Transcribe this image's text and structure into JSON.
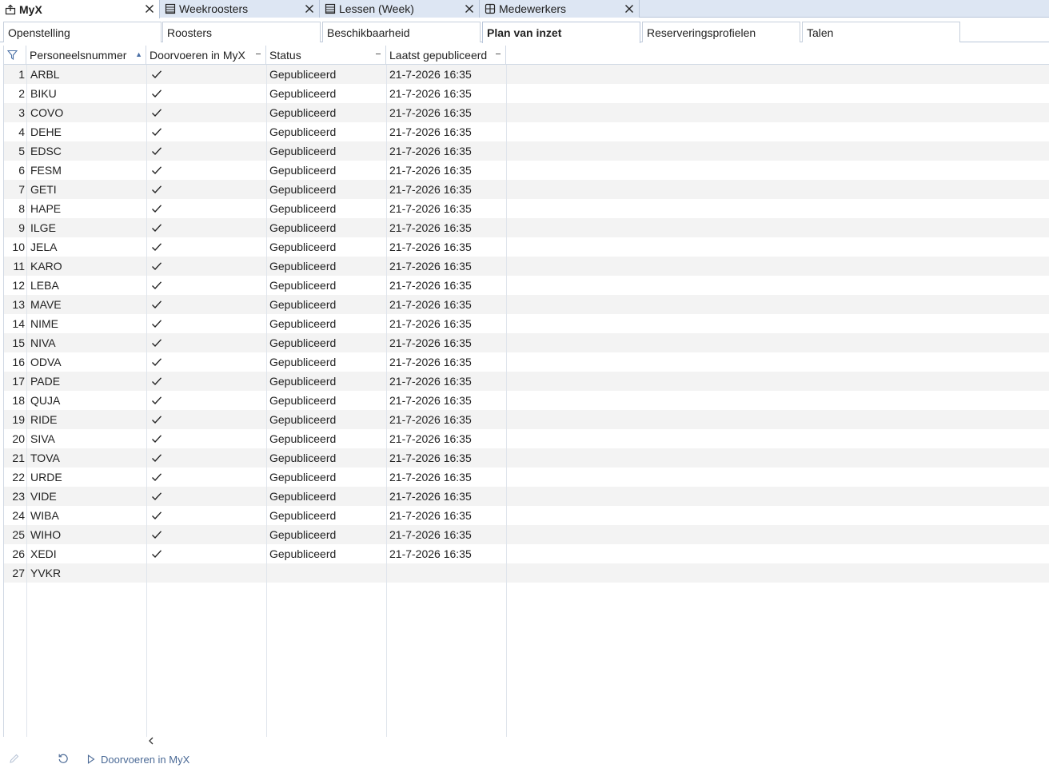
{
  "doc_tabs": [
    {
      "label": "MyX",
      "icon": "export-icon",
      "active": true
    },
    {
      "label": "Weekroosters",
      "icon": "table-icon",
      "active": false
    },
    {
      "label": "Lessen (Week)",
      "icon": "table-icon",
      "active": false
    },
    {
      "label": "Medewerkers",
      "icon": "grid-icon",
      "active": false
    }
  ],
  "sub_tabs": [
    {
      "label": "Openstelling"
    },
    {
      "label": "Roosters"
    },
    {
      "label": "Beschikbaarheid"
    },
    {
      "label": "Plan van inzet",
      "active": true
    },
    {
      "label": "Reserveringsprofielen"
    },
    {
      "label": "Talen"
    }
  ],
  "columns": {
    "personeelsnummer": "Personeelsnummer",
    "doorvoeren": "Doorvoeren in MyX",
    "status": "Status",
    "laatst": "Laatst gepubliceerd"
  },
  "rows": [
    {
      "n": "1",
      "pn": "ARBL",
      "checked": true,
      "status": "Gepubliceerd",
      "date": "21-7-2026 16:35"
    },
    {
      "n": "2",
      "pn": "BIKU",
      "checked": true,
      "status": "Gepubliceerd",
      "date": "21-7-2026 16:35"
    },
    {
      "n": "3",
      "pn": "COVO",
      "checked": true,
      "status": "Gepubliceerd",
      "date": "21-7-2026 16:35"
    },
    {
      "n": "4",
      "pn": "DEHE",
      "checked": true,
      "status": "Gepubliceerd",
      "date": "21-7-2026 16:35"
    },
    {
      "n": "5",
      "pn": "EDSC",
      "checked": true,
      "status": "Gepubliceerd",
      "date": "21-7-2026 16:35"
    },
    {
      "n": "6",
      "pn": "FESM",
      "checked": true,
      "status": "Gepubliceerd",
      "date": "21-7-2026 16:35"
    },
    {
      "n": "7",
      "pn": "GETI",
      "checked": true,
      "status": "Gepubliceerd",
      "date": "21-7-2026 16:35"
    },
    {
      "n": "8",
      "pn": "HAPE",
      "checked": true,
      "status": "Gepubliceerd",
      "date": "21-7-2026 16:35"
    },
    {
      "n": "9",
      "pn": "ILGE",
      "checked": true,
      "status": "Gepubliceerd",
      "date": "21-7-2026 16:35"
    },
    {
      "n": "10",
      "pn": "JELA",
      "checked": true,
      "status": "Gepubliceerd",
      "date": "21-7-2026 16:35"
    },
    {
      "n": "11",
      "pn": "KARO",
      "checked": true,
      "status": "Gepubliceerd",
      "date": "21-7-2026 16:35"
    },
    {
      "n": "12",
      "pn": "LEBA",
      "checked": true,
      "status": "Gepubliceerd",
      "date": "21-7-2026 16:35"
    },
    {
      "n": "13",
      "pn": "MAVE",
      "checked": true,
      "status": "Gepubliceerd",
      "date": "21-7-2026 16:35"
    },
    {
      "n": "14",
      "pn": "NIME",
      "checked": true,
      "status": "Gepubliceerd",
      "date": "21-7-2026 16:35"
    },
    {
      "n": "15",
      "pn": "NIVA",
      "checked": true,
      "status": "Gepubliceerd",
      "date": "21-7-2026 16:35"
    },
    {
      "n": "16",
      "pn": "ODVA",
      "checked": true,
      "status": "Gepubliceerd",
      "date": "21-7-2026 16:35"
    },
    {
      "n": "17",
      "pn": "PADE",
      "checked": true,
      "status": "Gepubliceerd",
      "date": "21-7-2026 16:35"
    },
    {
      "n": "18",
      "pn": "QUJA",
      "checked": true,
      "status": "Gepubliceerd",
      "date": "21-7-2026 16:35"
    },
    {
      "n": "19",
      "pn": "RIDE",
      "checked": true,
      "status": "Gepubliceerd",
      "date": "21-7-2026 16:35"
    },
    {
      "n": "20",
      "pn": "SIVA",
      "checked": true,
      "status": "Gepubliceerd",
      "date": "21-7-2026 16:35"
    },
    {
      "n": "21",
      "pn": "TOVA",
      "checked": true,
      "status": "Gepubliceerd",
      "date": "21-7-2026 16:35"
    },
    {
      "n": "22",
      "pn": "URDE",
      "checked": true,
      "status": "Gepubliceerd",
      "date": "21-7-2026 16:35"
    },
    {
      "n": "23",
      "pn": "VIDE",
      "checked": true,
      "status": "Gepubliceerd",
      "date": "21-7-2026 16:35"
    },
    {
      "n": "24",
      "pn": "WIBA",
      "checked": true,
      "status": "Gepubliceerd",
      "date": "21-7-2026 16:35"
    },
    {
      "n": "25",
      "pn": "WIHO",
      "checked": true,
      "status": "Gepubliceerd",
      "date": "21-7-2026 16:35"
    },
    {
      "n": "26",
      "pn": "XEDI",
      "checked": true,
      "status": "Gepubliceerd",
      "date": "21-7-2026 16:35"
    },
    {
      "n": "27",
      "pn": "YVKR",
      "checked": false,
      "status": "",
      "date": ""
    }
  ],
  "toolbar": {
    "push_label": "Doorvoeren in MyX"
  },
  "colors": {
    "accent": "#4b6a96",
    "tab_bar": "#dde6f3",
    "row_alt": "#f3f3f3"
  }
}
